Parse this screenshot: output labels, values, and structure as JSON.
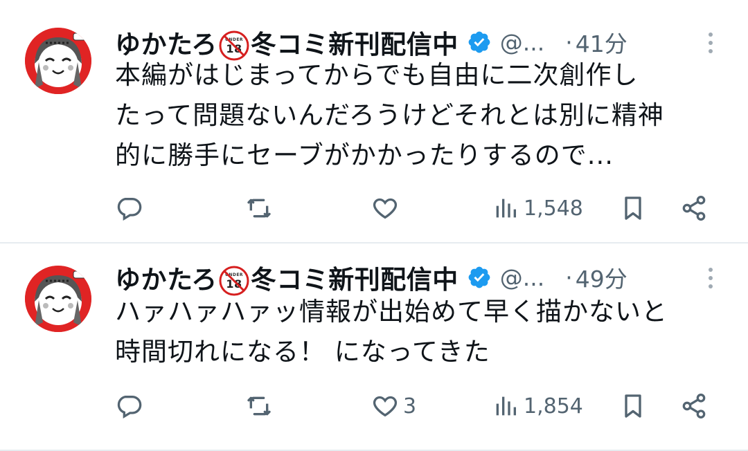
{
  "tweets": [
    {
      "author": {
        "name_prefix": "ゆかたろ",
        "name_suffix": "冬コミ新刊配信中",
        "badge_icon": "under-18-prohibited-icon",
        "handle": "@...",
        "time": "41分"
      },
      "text_lines": [
        "本編がはじまってからでも自由に二次創作し",
        "たって問題ないんだろうけどそれとは別に精神",
        "的に勝手にセーブがかかったりするので..."
      ],
      "stats": {
        "replies": "",
        "retweets": "",
        "likes": "",
        "views": "1,548"
      }
    },
    {
      "author": {
        "name_prefix": "ゆかたろ",
        "name_suffix": "冬コミ新刊配信中",
        "badge_icon": "under-18-prohibited-icon",
        "handle": "@...",
        "time": "49分"
      },
      "text_lines": [
        "ハァハァハァッ情報が出始めて早く描かないと",
        "時間切れになる！ になってきた"
      ],
      "stats": {
        "replies": "",
        "retweets": "",
        "likes": "3",
        "views": "1,854"
      }
    }
  ],
  "icons": {
    "verified": "verified-badge-icon",
    "more": "more-vertical-icon",
    "reply": "reply-icon",
    "retweet": "retweet-icon",
    "like": "heart-icon",
    "views": "views-chart-icon",
    "bookmark": "bookmark-icon",
    "share": "share-icon"
  },
  "colors": {
    "verified_blue": "#1d9bf0",
    "secondary_text": "#536471",
    "divider": "#e6ecf0",
    "avatar_red": "#e02424"
  },
  "separator": "·"
}
